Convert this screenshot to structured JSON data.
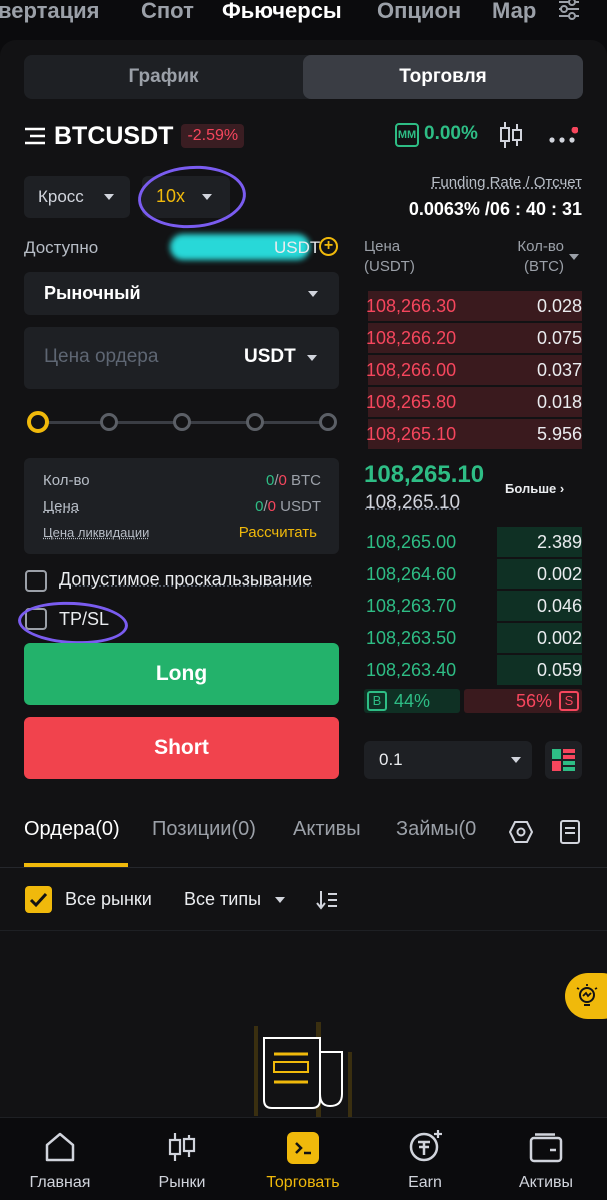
{
  "top_nav": [
    "вертация",
    "Спот",
    "Фьючерсы",
    "Опцион",
    "Мар"
  ],
  "segments": [
    "График",
    "Торговля"
  ],
  "pair": {
    "symbol": "BTCUSDT",
    "change": "-2.59%",
    "mm_label": "MM",
    "mm_value": "0.00%"
  },
  "margin_mode": "Кросс",
  "leverage": "10x",
  "funding": {
    "label": "Funding Rate / Отсчет",
    "value": "0.0063% /06 : 40 : 31"
  },
  "available": {
    "label": "Доступно",
    "unit_partial": "USDT"
  },
  "order_type": "Рыночный",
  "price_input": {
    "placeholder": "Цена ордера",
    "unit": "USDT"
  },
  "slider": {
    "fraction": 0
  },
  "summary": {
    "qty_label": "Кол-во",
    "qty_value_a": "0",
    "qty_sep": "/",
    "qty_value_b": "0",
    "qty_unit": "BTC",
    "price_label": "Цена",
    "price_value_a": "0",
    "price_value_b": "0",
    "price_unit": "USDT",
    "liq_label": "Цена ликвидации",
    "liq_action": "Рассчитать"
  },
  "slippage_label": "Допустимое проскальзывание",
  "tpsl_label": "TP/SL",
  "long_label": "Long",
  "short_label": "Short",
  "orderbook": {
    "price_header": "Цена",
    "price_unit": "(USDT)",
    "qty_header": "Кол-во",
    "qty_unit": "(BTC)",
    "asks": [
      {
        "price": "108,266.30",
        "qty": "0.028",
        "depth": 0.98
      },
      {
        "price": "108,266.20",
        "qty": "0.075",
        "depth": 0.98
      },
      {
        "price": "108,266.00",
        "qty": "0.037",
        "depth": 0.98
      },
      {
        "price": "108,265.80",
        "qty": "0.018",
        "depth": 0.98
      },
      {
        "price": "108,265.10",
        "qty": "5.956",
        "depth": 0.98
      }
    ],
    "last_price": "108,265.10",
    "mark_price": "108,265.10",
    "more_label": "Больше ›",
    "bids": [
      {
        "price": "108,265.00",
        "qty": "2.389",
        "depth": 0.39
      },
      {
        "price": "108,264.60",
        "qty": "0.002",
        "depth": 0.39
      },
      {
        "price": "108,263.70",
        "qty": "0.046",
        "depth": 0.39
      },
      {
        "price": "108,263.50",
        "qty": "0.002",
        "depth": 0.39
      },
      {
        "price": "108,263.40",
        "qty": "0.059",
        "depth": 0.39
      }
    ],
    "buy_tag": "B",
    "buy_pct": "44%",
    "sell_pct": "56%",
    "sell_tag": "S",
    "step": "0.1"
  },
  "bottom_tabs": [
    "Ордера(0)",
    "Позиции(0)",
    "Активы",
    "Займы(0"
  ],
  "filters": {
    "all_markets": "Все рынки",
    "all_types": "Все типы"
  },
  "bottom_nav": [
    "Главная",
    "Рынки",
    "Торговать",
    "Earn",
    "Активы"
  ],
  "colors": {
    "green": "#2ebd85",
    "red": "#f6465d",
    "accent": "#f0b90b"
  }
}
